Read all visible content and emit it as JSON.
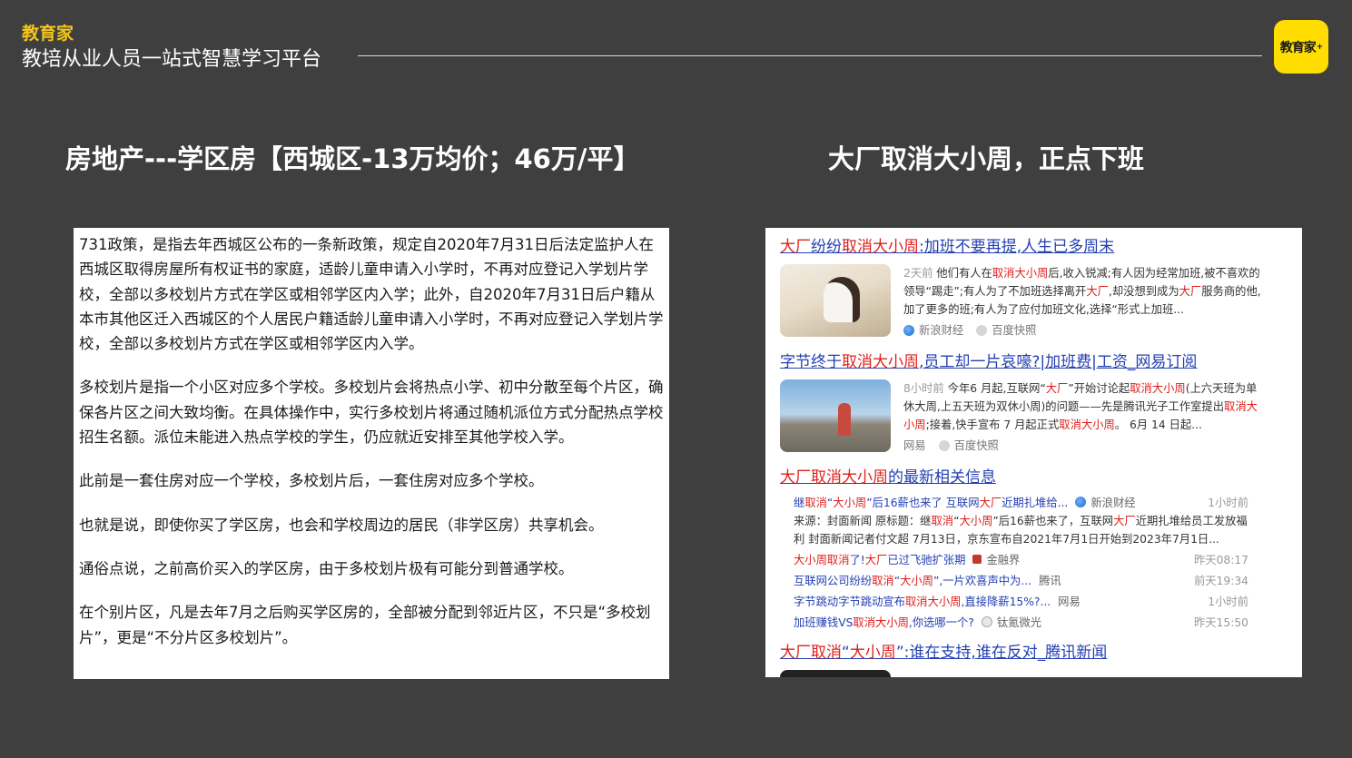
{
  "header": {
    "brand": "教育家",
    "subtitle": "教培从业人员一站式智慧学习平台",
    "logo_text": "教育家",
    "logo_mark": "+"
  },
  "left": {
    "heading": "房地产---学区房【西城区-13万均价；46万/平】",
    "paragraphs": [
      "731政策，是指去年西城区公布的一条新政策，规定自2020年7月31日后法定监护人在西城区取得房屋所有权证书的家庭，适龄儿童申请入小学时，不再对应登记入学划片学校，全部以多校划片方式在学区或相邻学区内入学；此外，自2020年7月31日后户籍从本市其他区迁入西城区的个人居民户籍适龄儿童申请入小学时，不再对应登记入学划片学校，全部以多校划片方式在学区或相邻学区内入学。",
      "多校划片是指一个小区对应多个学校。多校划片会将热点小学、初中分散至每个片区，确保各片区之间大致均衡。在具体操作中，实行多校划片将通过随机派位方式分配热点学校招生名额。派位未能进入热点学校的学生，仍应就近安排至其他学校入学。",
      "此前是一套住房对应一个学校，多校划片后，一套住房对应多个学校。",
      "也就是说，即使你买了学区房，也会和学校周边的居民（非学区房）共享机会。",
      "通俗点说，之前高价买入的学区房，由于多校划片极有可能分到普通学校。",
      "在个别片区，凡是去年7月之后购买学区房的，全部被分配到邻近片区，不只是“多校划片”，更是“不分片区多校划片”。"
    ]
  },
  "right": {
    "heading": "大厂取消大小周，正点下班",
    "results": [
      {
        "title_parts": [
          "大厂",
          "纷纷",
          "取消大小周",
          ":加班不要再提,人生已多周末"
        ],
        "time": "2天前",
        "body_parts": [
          "他们有人在",
          "取消大小周",
          "后,收入锐减;有人因为经常加班,被不喜欢的领导“踢走”;有人为了不加班选择离开",
          "大厂",
          ",却没想到成为",
          "大厂",
          "服务商的他,加了更多的班;有人为了应付加班文化,选择“形式上加班..."
        ],
        "source": "新浪财经",
        "snapshot": "百度快照"
      },
      {
        "title_parts": [
          "字节终于",
          "取消大小周",
          ",员工却一片哀嚎?|加班费|工资_网易订阅"
        ],
        "time": "8小时前",
        "body_parts": [
          "今年6 月起,互联网“",
          "大厂",
          "”开始讨论起",
          "取消大小周",
          "(上六天班为单休大周,上五天班为双休小周)的问题——先是腾讯光子工作室提出",
          "取消大小周",
          ";接着,快手宣布 7 月起正式",
          "取消大小周",
          "。 6月 14 日起..."
        ],
        "source": "网易",
        "snapshot": "百度快照"
      }
    ],
    "news_section": {
      "title_parts": [
        "大厂取消大小周",
        "的最新相关信息"
      ],
      "top": {
        "link_parts": [
          "继",
          "取消",
          "“",
          "大小周",
          "”后16薪也来了 互联网",
          "大厂",
          "近期扎堆给..."
        ],
        "source": "新浪财经",
        "time": "1小时前",
        "desc_parts": [
          "来源：封面新闻 原标题：继",
          "取消",
          "“",
          "大小周",
          "”后16薪也来了，互联网",
          "大厂",
          "近期扎堆给员工发放福利 封面新闻记者付文超 7月13日，京东宣布自2021年7月1日开始到2023年7月1日..."
        ]
      },
      "items": [
        {
          "link_parts": [
            "大小周取消",
            "了!",
            "大厂",
            "已过飞驰扩张期"
          ],
          "source": "金融界",
          "time": "昨天08:17"
        },
        {
          "link_parts": [
            "互联网公司纷纷",
            "取消",
            "“",
            "大小周",
            "”,一片欢喜声中为..."
          ],
          "source": "腾讯",
          "time": "前天19:34"
        },
        {
          "link_parts": [
            "字节跳动字节跳动宣布",
            "取消大小周",
            ",直接降薪15%?..."
          ],
          "source": "网易",
          "time": "1小时前"
        },
        {
          "link_parts": [
            "加班赚钱VS",
            "取消大小周",
            ",你选哪一个?"
          ],
          "source": "钛氪微光",
          "time": "昨天15:50"
        }
      ]
    },
    "last_result": {
      "title_parts": [
        "大厂取消",
        "“",
        "大小周",
        "”",
        ":谁在支持,谁在反对_腾讯新闻"
      ]
    }
  }
}
